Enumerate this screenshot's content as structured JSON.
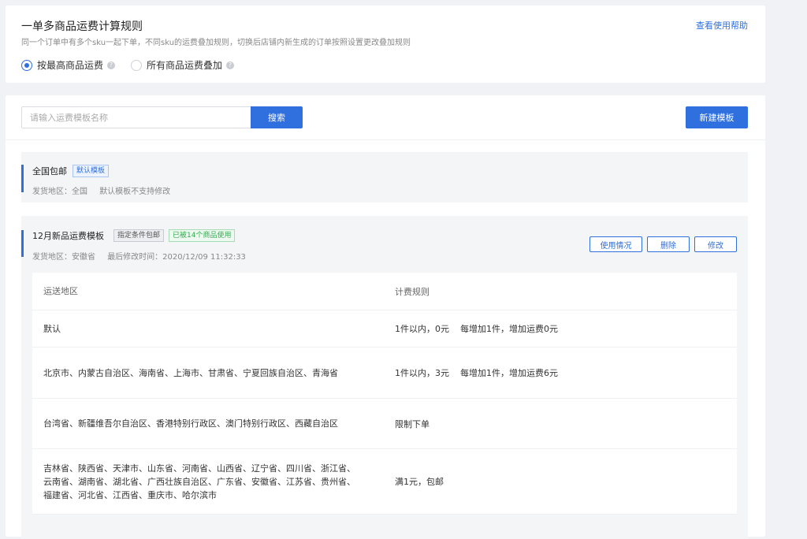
{
  "header": {
    "title": "一单多商品运费计算规则",
    "description": "同一个订单中有多个sku一起下单，不同sku的运费叠加规则，切换后店铺内新生成的订单按照设置更改叠加规则",
    "help_link": "查看使用帮助",
    "options": [
      {
        "label": "按最高商品运费",
        "checked": true
      },
      {
        "label": "所有商品运费叠加",
        "checked": false
      }
    ]
  },
  "toolbar": {
    "search_placeholder": "请输入运费模板名称",
    "search_label": "搜索",
    "new_label": "新建模板"
  },
  "templates": [
    {
      "name": "全国包邮",
      "tags": [
        "默认模板"
      ],
      "meta": [
        "发货地区：全国",
        "默认模板不支持修改"
      ]
    },
    {
      "name": "12月新品运费模板",
      "tags": [
        "指定条件包邮",
        "已被14个商品使用"
      ],
      "meta": [
        "发货地区：安徽省",
        "最后修改时间：2020/12/09 11:32:33"
      ],
      "actions": [
        "使用情况",
        "删除",
        "修改"
      ],
      "table": {
        "headers": [
          "运送地区",
          "计费规则"
        ],
        "rows": [
          {
            "region": "默认",
            "rule": [
              "1件以内，0元",
              "每增加1件，增加运费0元"
            ]
          },
          {
            "region": "北京市、内蒙古自治区、海南省、上海市、甘肃省、宁夏回族自治区、青海省",
            "rule": [
              "1件以内，3元",
              "每增加1件，增加运费6元"
            ]
          },
          {
            "region": "台湾省、新疆维吾尔自治区、香港特别行政区、澳门特别行政区、西藏自治区",
            "rule": [
              "限制下单",
              ""
            ]
          },
          {
            "region": "吉林省、陕西省、天津市、山东省、河南省、山西省、辽宁省、四川省、浙江省、云南省、湖南省、湖北省、广西壮族自治区、广东省、安徽省、江苏省、贵州省、福建省、河北省、江西省、重庆市、哈尔滨市",
            "rule": [
              "满1元，包邮",
              ""
            ]
          }
        ]
      }
    }
  ],
  "colors": {
    "accent": "#2f6fde",
    "success": "#2fae4c"
  }
}
